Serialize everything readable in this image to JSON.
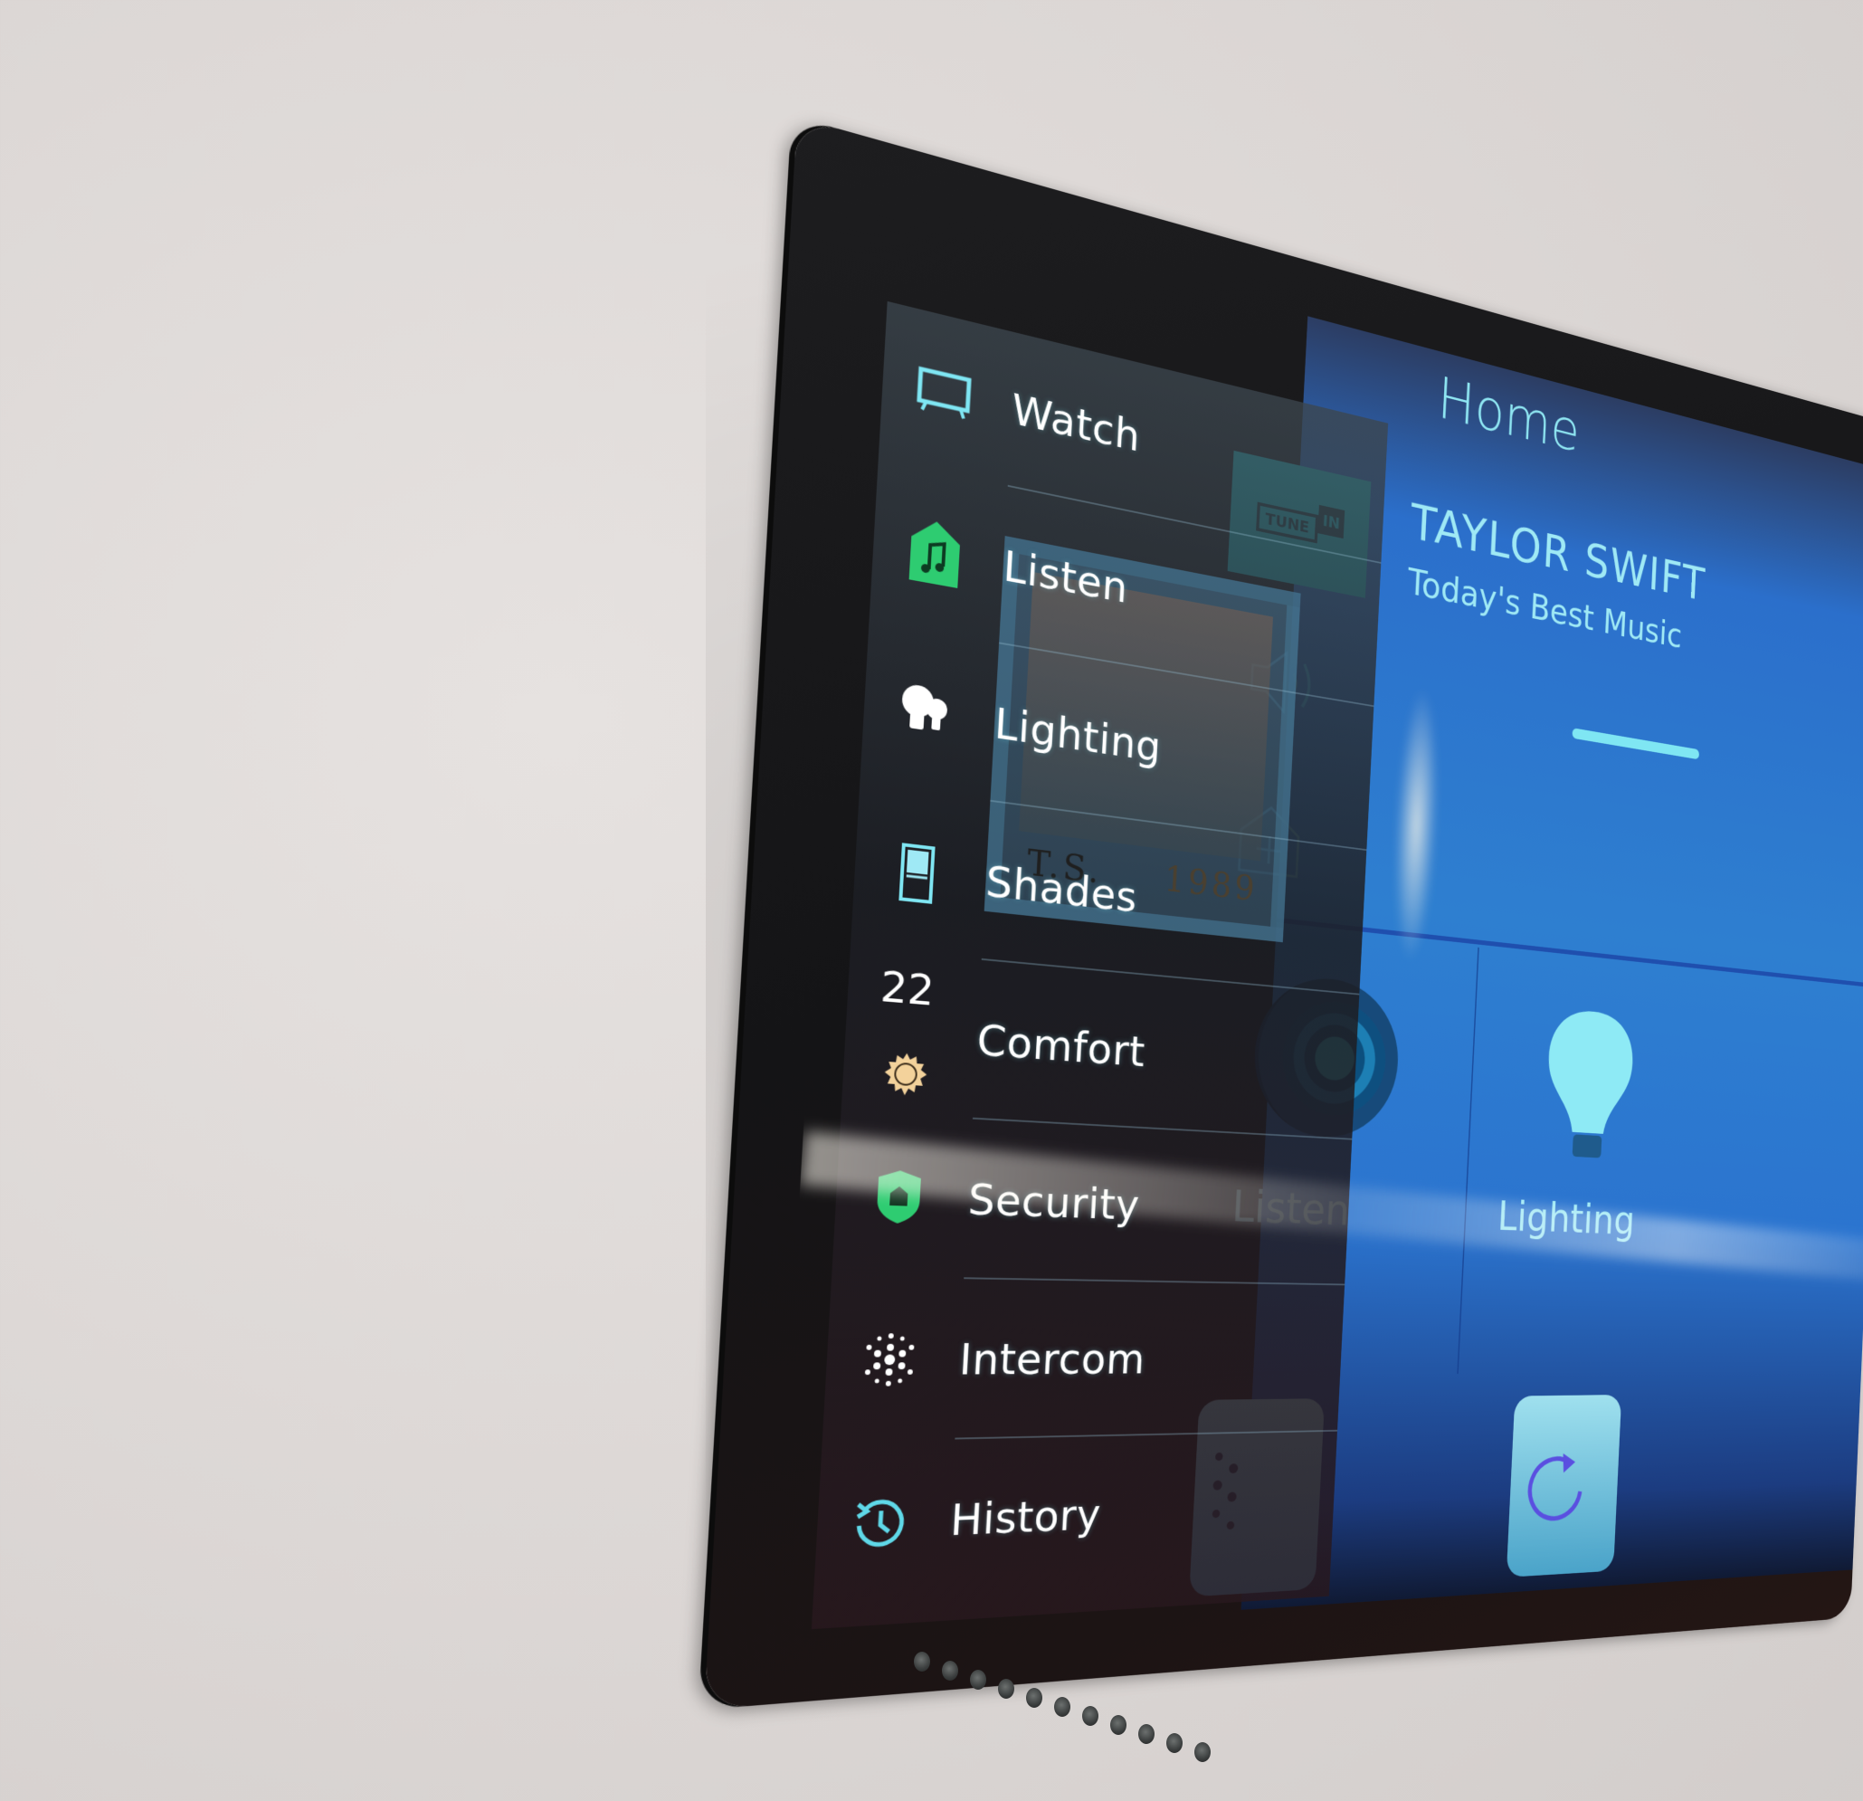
{
  "app": {
    "title": "Home"
  },
  "sidebar": {
    "items": [
      {
        "id": "watch",
        "label": "Watch",
        "icon": "tv-icon",
        "icon_color": "#7fe6f3"
      },
      {
        "id": "listen",
        "label": "Listen",
        "icon": "music-house-icon",
        "icon_color": "#2ecc71",
        "active": true
      },
      {
        "id": "lighting",
        "label": "Lighting",
        "icon": "bulbs-icon",
        "icon_color": "#ffffff"
      },
      {
        "id": "shades",
        "label": "Shades",
        "icon": "shade-icon",
        "icon_color": "#7fe6f3"
      },
      {
        "id": "comfort",
        "label": "Comfort",
        "icon": "sun-icon",
        "icon_color": "#f3d29b",
        "temperature": "22"
      },
      {
        "id": "security",
        "label": "Security",
        "icon": "shield-house-icon",
        "icon_color": "#2ecc71"
      },
      {
        "id": "intercom",
        "label": "Intercom",
        "icon": "intercom-dots-icon",
        "icon_color": "#ffffff"
      },
      {
        "id": "history",
        "label": "History",
        "icon": "history-clock-icon",
        "icon_color": "#5fd8e8"
      }
    ]
  },
  "album_art": {
    "caption_left": "T.S.",
    "caption_right": "1989"
  },
  "now_playing": {
    "station_logo": {
      "left": "TUNE",
      "right": "IN"
    },
    "artist": "TAYLOR SWIFT",
    "station": "Today's Best Music",
    "volume": 0.35
  },
  "tiles": [
    {
      "id": "listen",
      "label": "Listen"
    },
    {
      "id": "lighting",
      "label": "Lighting"
    }
  ],
  "colors": {
    "accent": "#7fe6f3",
    "active_green": "#2ecc71",
    "main_bg": "#2e7fd0",
    "wall": "#dcd7d5"
  }
}
